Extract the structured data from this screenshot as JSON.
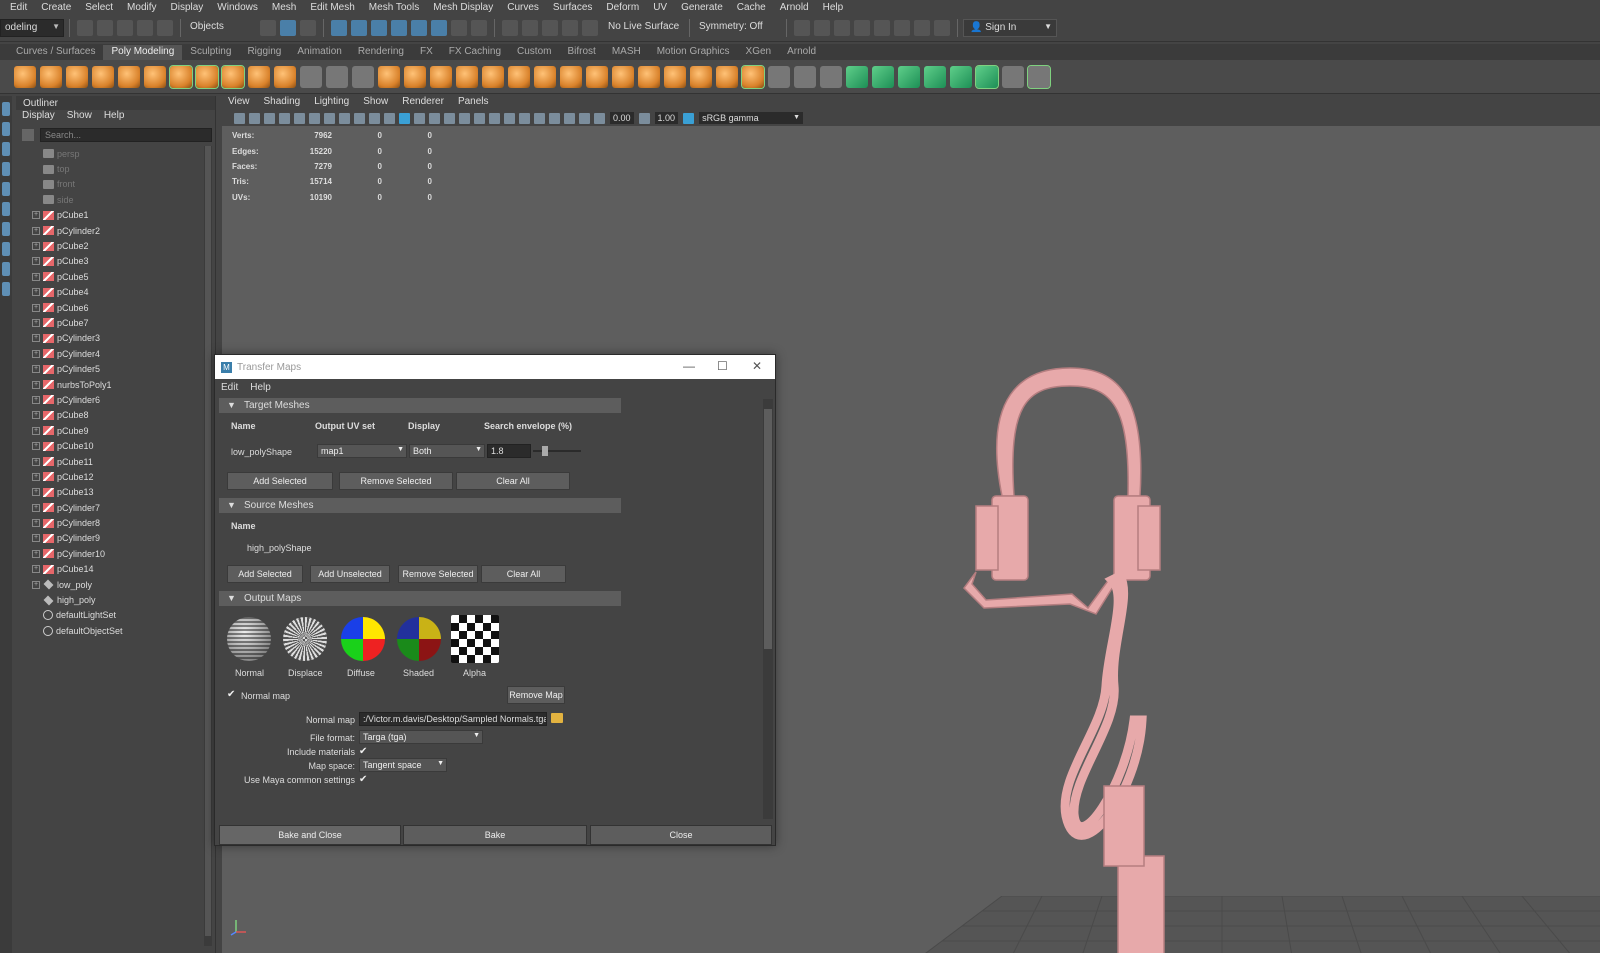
{
  "menubar": [
    "Edit",
    "Create",
    "Select",
    "Modify",
    "Display",
    "Windows",
    "Mesh",
    "Edit Mesh",
    "Mesh Tools",
    "Mesh Display",
    "Curves",
    "Surfaces",
    "Deform",
    "UV",
    "Generate",
    "Cache",
    "Arnold",
    "Help"
  ],
  "statusline": {
    "workspace": "odeling",
    "select_mode": "Objects",
    "live_surface": "No Live Surface",
    "symmetry": "Symmetry: Off",
    "sign_in": "Sign In"
  },
  "shelf_tabs": [
    "Curves / Surfaces",
    "Poly Modeling",
    "Sculpting",
    "Rigging",
    "Animation",
    "Rendering",
    "FX",
    "FX Caching",
    "Custom",
    "Bifrost",
    "MASH",
    "Motion Graphics",
    "XGen",
    "Arnold"
  ],
  "shelf_active_tab": "Poly Modeling",
  "outliner": {
    "title": "Outliner",
    "menus": [
      "Display",
      "Show",
      "Help"
    ],
    "search_placeholder": "Search...",
    "items": [
      {
        "label": "persp",
        "type": "camera",
        "dim": true,
        "expandable": false
      },
      {
        "label": "top",
        "type": "camera",
        "dim": true,
        "expandable": false
      },
      {
        "label": "front",
        "type": "camera",
        "dim": true,
        "expandable": false
      },
      {
        "label": "side",
        "type": "camera",
        "dim": true,
        "expandable": false
      },
      {
        "label": "pCube1",
        "type": "mesh",
        "dim": false,
        "expandable": true
      },
      {
        "label": "pCylinder2",
        "type": "mesh",
        "dim": false,
        "expandable": true
      },
      {
        "label": "pCube2",
        "type": "mesh",
        "dim": false,
        "expandable": true
      },
      {
        "label": "pCube3",
        "type": "mesh",
        "dim": false,
        "expandable": true
      },
      {
        "label": "pCube5",
        "type": "mesh",
        "dim": false,
        "expandable": true
      },
      {
        "label": "pCube4",
        "type": "mesh",
        "dim": false,
        "expandable": true
      },
      {
        "label": "pCube6",
        "type": "mesh",
        "dim": false,
        "expandable": true
      },
      {
        "label": "pCube7",
        "type": "mesh",
        "dim": false,
        "expandable": true
      },
      {
        "label": "pCylinder3",
        "type": "mesh",
        "dim": false,
        "expandable": true
      },
      {
        "label": "pCylinder4",
        "type": "mesh",
        "dim": false,
        "expandable": true
      },
      {
        "label": "pCylinder5",
        "type": "mesh",
        "dim": false,
        "expandable": true
      },
      {
        "label": "nurbsToPoly1",
        "type": "mesh",
        "dim": false,
        "expandable": true
      },
      {
        "label": "pCylinder6",
        "type": "mesh",
        "dim": false,
        "expandable": true
      },
      {
        "label": "pCube8",
        "type": "mesh",
        "dim": false,
        "expandable": true
      },
      {
        "label": "pCube9",
        "type": "mesh",
        "dim": false,
        "expandable": true
      },
      {
        "label": "pCube10",
        "type": "mesh",
        "dim": false,
        "expandable": true
      },
      {
        "label": "pCube11",
        "type": "mesh",
        "dim": false,
        "expandable": true
      },
      {
        "label": "pCube12",
        "type": "mesh",
        "dim": false,
        "expandable": true
      },
      {
        "label": "pCube13",
        "type": "mesh",
        "dim": false,
        "expandable": true
      },
      {
        "label": "pCylinder7",
        "type": "mesh",
        "dim": false,
        "expandable": true
      },
      {
        "label": "pCylinder8",
        "type": "mesh",
        "dim": false,
        "expandable": true
      },
      {
        "label": "pCylinder9",
        "type": "mesh",
        "dim": false,
        "expandable": true
      },
      {
        "label": "pCylinder10",
        "type": "mesh",
        "dim": false,
        "expandable": true
      },
      {
        "label": "pCube14",
        "type": "mesh",
        "dim": false,
        "expandable": true
      },
      {
        "label": "low_poly",
        "type": "group",
        "dim": false,
        "expandable": true
      },
      {
        "label": "high_poly",
        "type": "group",
        "dim": false,
        "expandable": false
      },
      {
        "label": "defaultLightSet",
        "type": "set",
        "dim": false,
        "expandable": false
      },
      {
        "label": "defaultObjectSet",
        "type": "set",
        "dim": false,
        "expandable": false
      }
    ]
  },
  "viewport": {
    "menus": [
      "View",
      "Shading",
      "Lighting",
      "Show",
      "Renderer",
      "Panels"
    ],
    "exposure": "0.00",
    "gamma": "1.00",
    "color_space": "sRGB gamma",
    "hud": [
      {
        "label": "Verts:",
        "v1": "7962",
        "v2": "0",
        "v3": "0"
      },
      {
        "label": "Edges:",
        "v1": "15220",
        "v2": "0",
        "v3": "0"
      },
      {
        "label": "Faces:",
        "v1": "7279",
        "v2": "0",
        "v3": "0"
      },
      {
        "label": "Tris:",
        "v1": "15714",
        "v2": "0",
        "v3": "0"
      },
      {
        "label": "UVs:",
        "v1": "10190",
        "v2": "0",
        "v3": "0"
      }
    ],
    "model_color": "#e7a9aa"
  },
  "dialog": {
    "title": "Transfer Maps",
    "menus": [
      "Edit",
      "Help"
    ],
    "target": {
      "header": "Target Meshes",
      "col_name": "Name",
      "col_uv": "Output UV set",
      "col_display": "Display",
      "col_envelope": "Search envelope (%)",
      "mesh_name": "low_polyShape",
      "uv_set": "map1",
      "display": "Both",
      "envelope": "1.8",
      "envelope_fraction": 0.18,
      "btn_add": "Add Selected",
      "btn_remove": "Remove Selected",
      "btn_clear": "Clear All"
    },
    "source": {
      "header": "Source Meshes",
      "col_name": "Name",
      "mesh_name": "high_polyShape",
      "btn_add": "Add Selected",
      "btn_add_unsel": "Add Unselected",
      "btn_remove": "Remove Selected",
      "btn_clear": "Clear All"
    },
    "output": {
      "header": "Output Maps",
      "maps": [
        "Normal",
        "Displace",
        "Diffuse",
        "Shaded",
        "Alpha"
      ],
      "normal_map_checkbox": "Normal map",
      "btn_remove_map": "Remove Map",
      "normal_map_label": "Normal map",
      "normal_map_path": ":/Victor.m.davis/Desktop/Sampled Normals.tga",
      "file_format_label": "File format:",
      "file_format": "Targa (tga)",
      "include_materials_label": "Include materials",
      "map_space_label": "Map space:",
      "map_space": "Tangent space",
      "use_common_label": "Use Maya common settings"
    },
    "btn_bake_close": "Bake and Close",
    "btn_bake": "Bake",
    "btn_close": "Close"
  }
}
